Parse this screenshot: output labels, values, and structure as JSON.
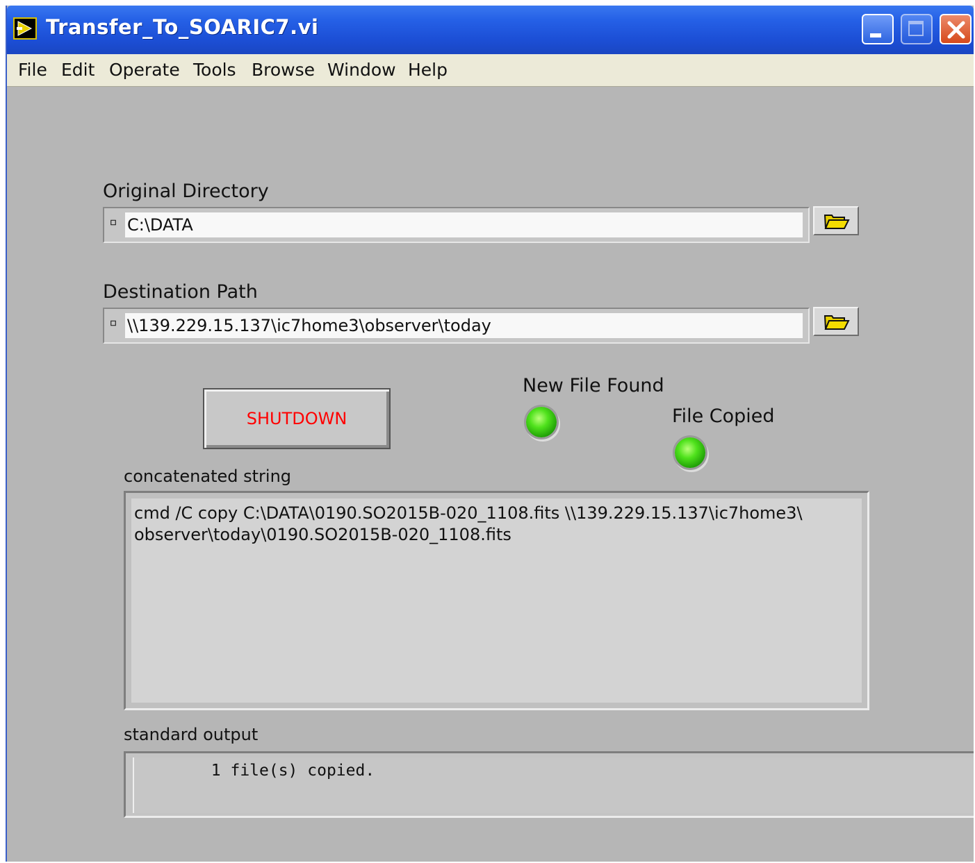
{
  "window": {
    "title": "Transfer_To_SOARIC7.vi",
    "controls": [
      "minimize-icon",
      "maximize-icon",
      "close-icon"
    ]
  },
  "menubar": {
    "items": [
      {
        "label": "File"
      },
      {
        "label": "Edit"
      },
      {
        "label": "Operate"
      },
      {
        "label": "Tools"
      },
      {
        "label": "Browse"
      },
      {
        "label": "Window"
      },
      {
        "label": "Help"
      }
    ]
  },
  "original_directory": {
    "label": "Original Directory",
    "value": "C:\\DATA",
    "browse_icon": "folder-open-icon"
  },
  "destination_path": {
    "label": "Destination Path",
    "value": "\\\\139.229.15.137\\ic7home3\\observer\\today",
    "browse_icon": "folder-open-icon"
  },
  "shutdown": {
    "label": "SHUTDOWN",
    "color": "#ff0000"
  },
  "indicators": {
    "new_file_found": {
      "label": "New File Found",
      "state": "on",
      "color": "#3ad60f"
    },
    "file_copied": {
      "label": "File Copied",
      "state": "on",
      "color": "#3ad60f"
    }
  },
  "concatenated_string": {
    "label": "concatenated string",
    "value": "cmd /C copy C:\\DATA\\0190.SO2015B-020_1108.fits \\\\139.229.15.137\\ic7home3\\\nobserver\\today\\0190.SO2015B-020_1108.fits"
  },
  "standard_output": {
    "label": "standard output",
    "value": "        1 file(s) copied."
  }
}
